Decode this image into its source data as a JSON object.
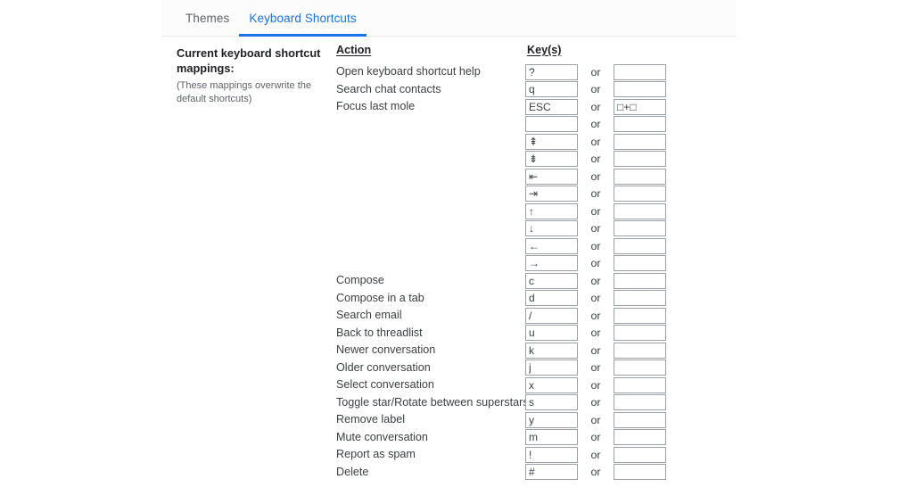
{
  "tabs": [
    {
      "label": "Themes",
      "active": false
    },
    {
      "label": "Keyboard Shortcuts",
      "active": true
    }
  ],
  "colors": {
    "accent": "#1a73e8",
    "tabbar_bg": "#fcfcfc",
    "tabbar_border": "#e8eaed",
    "text_primary": "#202124",
    "text_body": "#3c4043",
    "text_muted": "#5f6368",
    "input_border": "#9aa0a6"
  },
  "description": {
    "title": "Current keyboard shortcut mappings:",
    "subtitle": "(These mappings overwrite the default shortcuts)"
  },
  "table": {
    "headers": {
      "action": "Action",
      "keys": "Key(s)"
    },
    "or_label": "or",
    "rows": [
      {
        "action": "Open keyboard shortcut help",
        "key1": "?",
        "key2": ""
      },
      {
        "action": "Search chat contacts",
        "key1": "q",
        "key2": ""
      },
      {
        "action": "Focus last mole",
        "key1": "ESC",
        "key2": "□+□"
      },
      {
        "action": "",
        "key1": "",
        "key2": ""
      },
      {
        "action": "",
        "key1": "⇞",
        "key2": ""
      },
      {
        "action": "",
        "key1": "⇟",
        "key2": ""
      },
      {
        "action": "",
        "key1": "⇤",
        "key2": ""
      },
      {
        "action": "",
        "key1": "⇥",
        "key2": ""
      },
      {
        "action": "",
        "key1": "↑",
        "key2": ""
      },
      {
        "action": "",
        "key1": "↓",
        "key2": ""
      },
      {
        "action": "",
        "key1": "←",
        "key2": ""
      },
      {
        "action": "",
        "key1": "→",
        "key2": ""
      },
      {
        "action": "Compose",
        "key1": "c",
        "key2": ""
      },
      {
        "action": "Compose in a tab",
        "key1": "d",
        "key2": ""
      },
      {
        "action": "Search email",
        "key1": "/",
        "key2": ""
      },
      {
        "action": "Back to threadlist",
        "key1": "u",
        "key2": ""
      },
      {
        "action": "Newer conversation",
        "key1": "k",
        "key2": ""
      },
      {
        "action": "Older conversation",
        "key1": "j",
        "key2": ""
      },
      {
        "action": "Select conversation",
        "key1": "x",
        "key2": ""
      },
      {
        "action": "Toggle star/Rotate between superstars",
        "key1": "s",
        "key2": ""
      },
      {
        "action": "Remove label",
        "key1": "y",
        "key2": ""
      },
      {
        "action": "Mute conversation",
        "key1": "m",
        "key2": ""
      },
      {
        "action": "Report as spam",
        "key1": "!",
        "key2": ""
      },
      {
        "action": "Delete",
        "key1": "#",
        "key2": ""
      }
    ]
  }
}
